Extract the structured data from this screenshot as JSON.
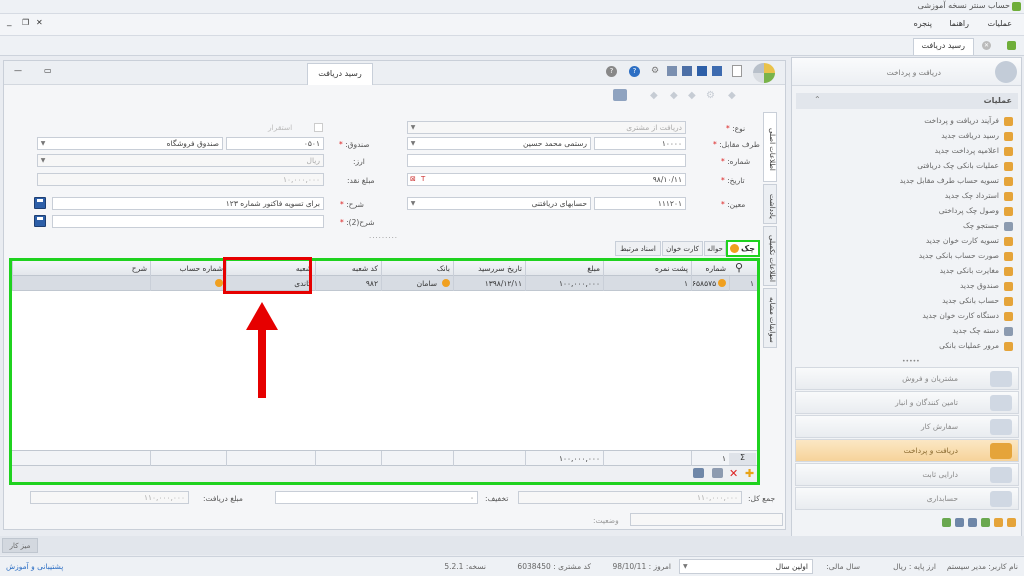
{
  "app_title": "حساب سنتر نسخه آموزشی",
  "menu": [
    "عملیات",
    "راهنما",
    "پنجره"
  ],
  "doc_tab": "رسید دریافت",
  "form": {
    "title": "رسید دریافت",
    "type_label": "نوع:",
    "type_value": "دریافت از مشتری",
    "party_label": "طرف مقابل:",
    "party_code": "۱۰۰۰۰",
    "party_name": "رستمی محمد حسین",
    "number_label": "شماره:",
    "date_label": "تاریخ:",
    "date_value": "۹۸/۱۰/۱۱",
    "moein_label": "معین:",
    "moein_code": "۱۱۱۲۰۱",
    "moein_name": "حسابهای دریافتنی",
    "fund_label": "صندوق:",
    "fund_code": "۰۵۰۱",
    "fund_name": "صندوق فروشگاه",
    "currency_label": "ارز:",
    "currency_value": "ریال",
    "cash_label": "مبلغ نقد:",
    "cash_value": "۱۰,۰۰۰,۰۰۰",
    "desc_label": "شرح:",
    "desc_value": "برای تسویه فاکتور شماره  ۱۲۳",
    "desc2_label": "شرح(2):",
    "istiqrar": "استقرار"
  },
  "side_tabs": [
    "اطلاعات اصلی",
    "یادداشت",
    "اطلاعات تکمیلی",
    "سوابقات مشابه"
  ],
  "grid_tabs": [
    "چک",
    "حواله",
    "کارت خوان",
    "اسناد مرتبط"
  ],
  "grid": {
    "columns": [
      "شماره",
      "پشت نمره",
      "مبلغ",
      "تاریخ سررسید",
      "بانک",
      "کد شعبه",
      "شعبه",
      "شماره حساب",
      "شرح"
    ],
    "row": {
      "index": "۱",
      "number": "۶۵۸۵۷۵",
      "back": "۱",
      "amount": "۱۰۰,۰۰۰,۰۰۰",
      "due": "۱۳۹۸/۱۲/۱۱",
      "bank": "سامان",
      "branch_code": "۹۸۲",
      "branch": "گاندی",
      "account": "",
      "desc": ""
    },
    "total_count": "۱",
    "total_amount": "۱۰۰,۰۰۰,۰۰۰"
  },
  "totals": {
    "sum_label": "جمع کل:",
    "sum_value": "۱۱۰,۰۰۰,۰۰۰",
    "discount_label": "تخفیف:",
    "discount_value": "۰",
    "received_label": "مبلغ دریافت:",
    "received_value": "۱۱۰,۰۰۰,۰۰۰",
    "status_label": "وضعیت:"
  },
  "right_panel": {
    "header": "دریافت و پرداخت",
    "ops_label": "عملیات",
    "items": [
      "فرآیند دریافت و پرداخت",
      "رسید دریافت جدید",
      "اعلامیه پرداخت جدید",
      "عملیات بانکی چک دریافتی",
      "تسویه حساب طرف مقابل جدید",
      "استرداد چک جدید",
      "وصول چک پرداختی",
      "جستجو چک",
      "تسویه کارت خوان جدید",
      "صورت حساب بانکی جدید",
      "مغایرت بانکی جدید",
      "صندوق جدید",
      "حساب بانکی جدید",
      "دستگاه کارت خوان جدید",
      "دسته چک جدید",
      "مرور عملیات بانکی"
    ],
    "sections": [
      "مشتریان و فروش",
      "تامین کنندگان و انبار",
      "سفارش کار",
      "دریافت و پرداخت",
      "دارایی ثابت",
      "حسابداری"
    ]
  },
  "taskbar_item": "میز کار",
  "status": {
    "user_label": "نام کاربر: مدیر سیستم",
    "base_currency": "ارز پایه :  ریال",
    "fiscal_label": "سال مالی:",
    "fiscal_value": "اولین سال",
    "today": "امروز :  98/10/11",
    "customer_code": "کد مشتری :  6038450",
    "version": "نسخه:  5.2.1",
    "support": "پشتیبانی و آموزش"
  }
}
